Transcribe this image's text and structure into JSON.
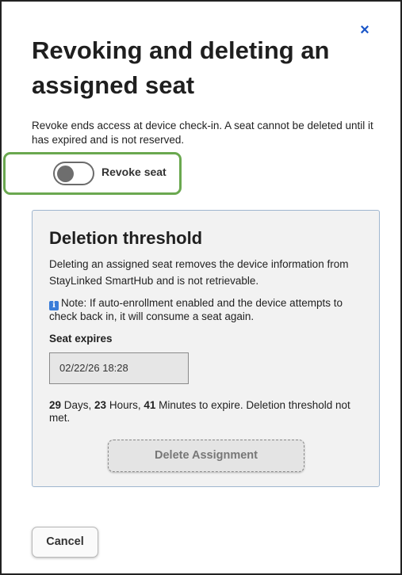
{
  "dialog": {
    "title": "Revoking and deleting an assigned seat",
    "close_icon": "×",
    "intro": "Revoke ends access at device check-in. A seat cannot be deleted until it has expired and is not reserved.",
    "toggle": {
      "label": "Revoke seat",
      "state": "off"
    },
    "highlight_color": "#6aa84f",
    "cancel_label": "Cancel"
  },
  "panel": {
    "title": "Deletion threshold",
    "description": "Deleting an assigned seat removes the device information from StayLinked SmartHub and is not retrievable.",
    "note_icon": "i",
    "note": "Note: If auto-enrollment enabled and the device attempts to check back in, it will consume a seat again.",
    "seat_label": "Seat expires",
    "seat_value": "02/22/26 18:28",
    "expire": {
      "days": "29",
      "days_unit": " Days, ",
      "hours": "23",
      "hours_unit": " Hours, ",
      "minutes": "41",
      "minutes_unit": " Minutes to expire. Deletion threshold not met."
    },
    "delete_label": "Delete Assignment"
  }
}
